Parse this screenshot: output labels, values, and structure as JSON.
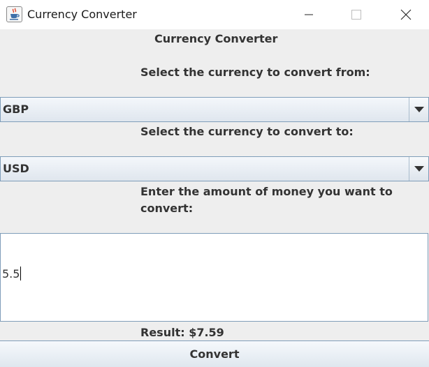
{
  "window": {
    "title": "Currency Converter",
    "icon": "java-cup-icon",
    "controls": [
      "minimize",
      "maximize",
      "close"
    ]
  },
  "form": {
    "heading": "Currency Converter",
    "from_label": "Select the currency to convert from:",
    "from_value": "GBP",
    "to_label": "Select the currency to convert to:",
    "to_value": "USD",
    "amount_label": "Enter the amount of money you want to convert:",
    "amount_value": "5.5",
    "result_text": "Result: $7.59",
    "convert_label": "Convert"
  },
  "colors": {
    "background": "#eeeeee",
    "border": "#7f9db9",
    "text": "#333333"
  }
}
